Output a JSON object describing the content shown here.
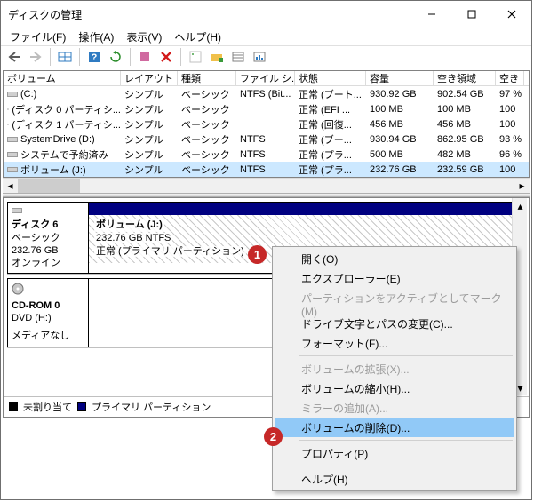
{
  "window": {
    "title": "ディスクの管理"
  },
  "menu": {
    "file": "ファイル(F)",
    "action": "操作(A)",
    "view": "表示(V)",
    "help": "ヘルプ(H)"
  },
  "columns": {
    "volume": "ボリューム",
    "layout": "レイアウト",
    "type": "種類",
    "filesystem": "ファイル シ...",
    "status": "状態",
    "capacity": "容量",
    "free": "空き領域",
    "pct": "空き"
  },
  "cw": {
    "vol": 132,
    "lay": 64,
    "type": 66,
    "fs": 66,
    "stat": 80,
    "cap": 76,
    "free": 70,
    "pct": 32
  },
  "rows": [
    {
      "vol": "(C:)",
      "lay": "シンプル",
      "type": "ベーシック",
      "fs": "NTFS (Bit...",
      "stat": "正常 (ブート...",
      "cap": "930.92 GB",
      "free": "902.54 GB",
      "pct": "97 %"
    },
    {
      "vol": "(ディスク 0 パーティシ...",
      "lay": "シンプル",
      "type": "ベーシック",
      "fs": "",
      "stat": "正常 (EFI ...",
      "cap": "100 MB",
      "free": "100 MB",
      "pct": "100"
    },
    {
      "vol": "(ディスク 1 パーティシ...",
      "lay": "シンプル",
      "type": "ベーシック",
      "fs": "",
      "stat": "正常 (回復...",
      "cap": "456 MB",
      "free": "456 MB",
      "pct": "100"
    },
    {
      "vol": "SystemDrive (D:)",
      "lay": "シンプル",
      "type": "ベーシック",
      "fs": "NTFS",
      "stat": "正常 (ブー...",
      "cap": "930.94 GB",
      "free": "862.95 GB",
      "pct": "93 %"
    },
    {
      "vol": "システムで予約済み",
      "lay": "シンプル",
      "type": "ベーシック",
      "fs": "NTFS",
      "stat": "正常 (プラ...",
      "cap": "500 MB",
      "free": "482 MB",
      "pct": "96 %"
    },
    {
      "vol": "ボリューム (J:)",
      "lay": "シンプル",
      "type": "ベーシック",
      "fs": "NTFS",
      "stat": "正常 (プラ...",
      "cap": "232.76 GB",
      "free": "232.59 GB",
      "pct": "100",
      "sel": true
    }
  ],
  "disk6": {
    "title": "ディスク 6",
    "type": "ベーシック",
    "size": "232.76 GB",
    "status": "オンライン",
    "vol": {
      "label": "ボリューム   (J:)",
      "size": "232.76 GB NTFS",
      "status": "正常 (プライマリ パーティション)"
    }
  },
  "cdrom": {
    "title": "CD-ROM 0",
    "drv": "DVD (H:)",
    "status": "メディアなし"
  },
  "legend": {
    "unallocated": "未割り当て",
    "primary": "プライマリ パーティション"
  },
  "ctx": {
    "open": "開く(O)",
    "explorer": "エクスプローラー(E)",
    "mark_active": "パーティションをアクティブとしてマーク(M)",
    "change_letter": "ドライブ文字とパスの変更(C)...",
    "format": "フォーマット(F)...",
    "extend": "ボリュームの拡張(X)...",
    "shrink": "ボリュームの縮小(H)...",
    "mirror": "ミラーの追加(A)...",
    "delete": "ボリュームの削除(D)...",
    "properties": "プロパティ(P)",
    "help": "ヘルプ(H)"
  },
  "badges": {
    "b1": "1",
    "b2": "2"
  }
}
